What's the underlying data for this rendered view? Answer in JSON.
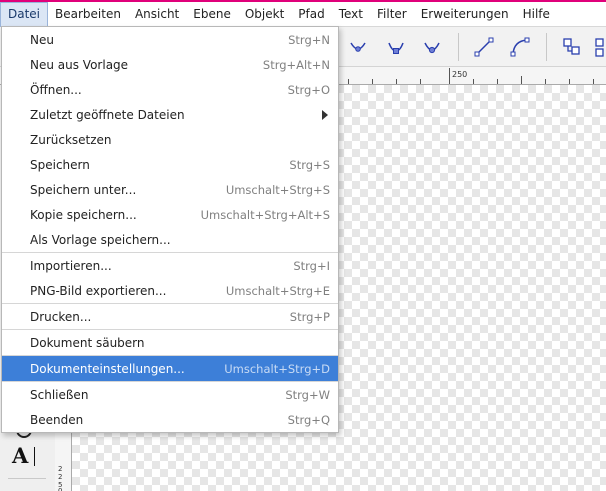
{
  "menubar": {
    "items": [
      {
        "label": "Datei",
        "active": true
      },
      {
        "label": "Bearbeiten"
      },
      {
        "label": "Ansicht"
      },
      {
        "label": "Ebene"
      },
      {
        "label": "Objekt"
      },
      {
        "label": "Pfad"
      },
      {
        "label": "Text"
      },
      {
        "label": "Filter"
      },
      {
        "label": "Erweiterungen"
      },
      {
        "label": "Hilfe"
      }
    ]
  },
  "toolbar": {
    "icons": [
      "node-symmetric-icon",
      "node-cusp-icon",
      "node-smooth-icon",
      "segment-line-icon",
      "segment-curve-icon",
      "object-to-path-icon",
      "stroke-to-path-icon"
    ]
  },
  "ruler": {
    "top_label": "250",
    "left_numbers": [
      "2",
      "2",
      "5",
      "0"
    ]
  },
  "menu": {
    "items": [
      {
        "label": "Neu",
        "shortcut": "Strg+N"
      },
      {
        "label": "Neu aus Vorlage",
        "shortcut": "Strg+Alt+N"
      },
      {
        "label": "Öffnen...",
        "shortcut": "Strg+O"
      },
      {
        "label": "Zuletzt geöffnete Dateien",
        "shortcut": "",
        "submenu": true
      },
      {
        "label": "Zurücksetzen",
        "shortcut": ""
      },
      {
        "label": "Speichern",
        "shortcut": "Strg+S"
      },
      {
        "label": "Speichern unter...",
        "shortcut": "Umschalt+Strg+S"
      },
      {
        "label": "Kopie speichern...",
        "shortcut": "Umschalt+Strg+Alt+S"
      },
      {
        "label": "Als Vorlage speichern...",
        "shortcut": ""
      },
      {
        "label": "Importieren...",
        "shortcut": "Strg+I"
      },
      {
        "label": "PNG-Bild exportieren...",
        "shortcut": "Umschalt+Strg+E"
      },
      {
        "label": "Drucken...",
        "shortcut": "Strg+P"
      },
      {
        "label": "Dokument säubern",
        "shortcut": ""
      },
      {
        "label": "Dokumenteinstellungen...",
        "shortcut": "Umschalt+Strg+D",
        "highlighted": true
      },
      {
        "label": "Schließen",
        "shortcut": "Strg+W"
      },
      {
        "label": "Beenden",
        "shortcut": "Strg+Q"
      }
    ]
  },
  "tools": {
    "text_tool_glyph": "A"
  },
  "colors": {
    "accent": "#e0007a",
    "highlight": "#3d7fd8",
    "icon_blue": "#2a3fae"
  }
}
